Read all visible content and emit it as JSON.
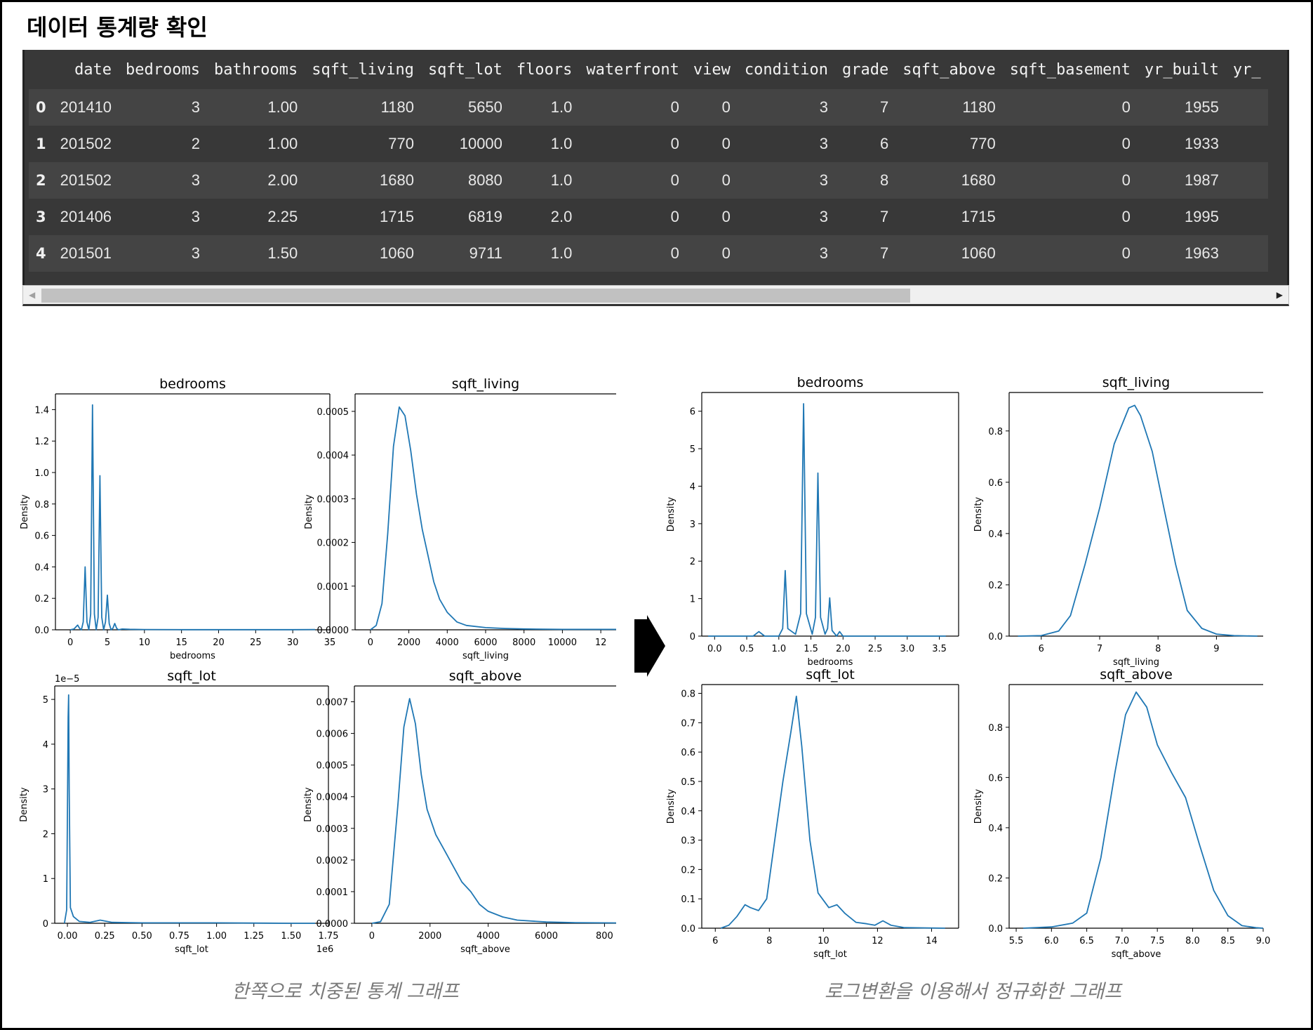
{
  "title": "데이터 통계량 확인",
  "table": {
    "columns": [
      "",
      "date",
      "bedrooms",
      "bathrooms",
      "sqft_living",
      "sqft_lot",
      "floors",
      "waterfront",
      "view",
      "condition",
      "grade",
      "sqft_above",
      "sqft_basement",
      "yr_built",
      "yr_"
    ],
    "rows": [
      [
        "0",
        "201410",
        "3",
        "1.00",
        "1180",
        "5650",
        "1.0",
        "0",
        "0",
        "3",
        "7",
        "1180",
        "0",
        "1955",
        ""
      ],
      [
        "1",
        "201502",
        "2",
        "1.00",
        "770",
        "10000",
        "1.0",
        "0",
        "0",
        "3",
        "6",
        "770",
        "0",
        "1933",
        ""
      ],
      [
        "2",
        "201502",
        "3",
        "2.00",
        "1680",
        "8080",
        "1.0",
        "0",
        "0",
        "3",
        "8",
        "1680",
        "0",
        "1987",
        ""
      ],
      [
        "3",
        "201406",
        "3",
        "2.25",
        "1715",
        "6819",
        "2.0",
        "0",
        "0",
        "3",
        "7",
        "1715",
        "0",
        "1995",
        ""
      ],
      [
        "4",
        "201501",
        "3",
        "1.50",
        "1060",
        "9711",
        "1.0",
        "0",
        "0",
        "3",
        "7",
        "1060",
        "0",
        "1963",
        ""
      ]
    ]
  },
  "scrollbar": {
    "left_arrow": "◀",
    "right_arrow": "▶",
    "thumb_fraction": 0.69
  },
  "arrow_icon": "right-arrow-icon",
  "captions": {
    "left": "한쪽으로 치중된 통계 그래프",
    "right": "로그변환을 이용해서 정규화한 그래프"
  },
  "colors": {
    "line": "#1f77b4",
    "table_bg": "#383838"
  },
  "chart_data": [
    {
      "type": "line",
      "title": "bedrooms",
      "xlabel": "bedrooms",
      "ylabel": "Density",
      "xlim": [
        -2,
        35
      ],
      "ylim": [
        0,
        1.5
      ],
      "xticks": [
        0,
        5,
        10,
        15,
        20,
        25,
        30,
        35
      ],
      "yticks": [
        0.0,
        0.2,
        0.4,
        0.6,
        0.8,
        1.0,
        1.2,
        1.4
      ],
      "ytick_labels": [
        "0.0",
        "0.2",
        "0.4",
        "0.6",
        "0.8",
        "1.0",
        "1.2",
        "1.4"
      ],
      "series": [
        {
          "x": [
            0,
            0.5,
            1,
            1.25,
            1.5,
            1.75,
            2,
            2.25,
            2.5,
            2.75,
            3,
            3.25,
            3.5,
            3.75,
            4,
            4.25,
            4.5,
            4.75,
            5,
            5.25,
            5.5,
            5.75,
            6,
            6.25,
            6.5,
            7,
            8,
            10,
            15,
            20,
            25,
            30,
            33
          ],
          "y": [
            0,
            0.005,
            0.03,
            0.01,
            0.0,
            0.05,
            0.4,
            0.05,
            0.0,
            0.1,
            1.43,
            0.1,
            0.0,
            0.08,
            0.98,
            0.08,
            0.0,
            0.05,
            0.22,
            0.04,
            0.0,
            0.01,
            0.04,
            0.01,
            0.0,
            0.005,
            0.003,
            0.002,
            0.001,
            0.001,
            0.001,
            0.001,
            0.002
          ]
        }
      ]
    },
    {
      "type": "line",
      "title": "sqft_living",
      "xlabel": "sqft_living",
      "ylabel": "Density",
      "xlim": [
        -800,
        12800
      ],
      "ylim": [
        0,
        0.00054
      ],
      "xticks": [
        0,
        2000,
        4000,
        6000,
        8000,
        10000,
        12000
      ],
      "xtick_labels": [
        "0",
        "2000",
        "4000",
        "6000",
        "8000",
        "10000",
        "12"
      ],
      "yticks": [
        0.0,
        0.0001,
        0.0002,
        0.0003,
        0.0004,
        0.0005
      ],
      "ytick_labels": [
        "0.0000",
        "0.0001",
        "0.0002",
        "0.0003",
        "0.0004",
        "0.0005"
      ],
      "series": [
        {
          "x": [
            0,
            300,
            600,
            900,
            1200,
            1500,
            1800,
            2100,
            2400,
            2700,
            3000,
            3300,
            3600,
            4000,
            4500,
            5000,
            6000,
            7000,
            8000,
            10000,
            12800
          ],
          "y": [
            0,
            1e-05,
            6e-05,
            0.00022,
            0.00042,
            0.00051,
            0.00049,
            0.00041,
            0.00031,
            0.00023,
            0.00017,
            0.00011,
            7e-05,
            4e-05,
            1.8e-05,
            1e-05,
            5e-06,
            3e-06,
            2e-06,
            1e-06,
            1e-06
          ]
        }
      ]
    },
    {
      "type": "line",
      "title": "sqft_lot",
      "xlabel": "sqft_lot",
      "ylabel": "Density",
      "offset_label": "1e−5",
      "xoffset_label": "1e6",
      "xlim": [
        -0.085,
        1.75
      ],
      "ylim": [
        0,
        5.3
      ],
      "xticks": [
        0,
        0.25,
        0.5,
        0.75,
        1.0,
        1.25,
        1.5,
        1.75
      ],
      "xtick_labels": [
        "0.00",
        "0.25",
        "0.50",
        "0.75",
        "1.00",
        "1.25",
        "1.50",
        "1.75"
      ],
      "yticks": [
        0,
        1,
        2,
        3,
        4,
        5
      ],
      "series": [
        {
          "x": [
            -0.02,
            -0.005,
            0.0,
            0.005,
            0.008,
            0.012,
            0.02,
            0.04,
            0.08,
            0.15,
            0.22,
            0.3,
            0.5,
            1.0,
            1.5,
            1.66
          ],
          "y": [
            0,
            0.3,
            2.5,
            4.6,
            5.1,
            3.0,
            0.35,
            0.15,
            0.04,
            0.02,
            0.07,
            0.02,
            0.01,
            0.01,
            0.0,
            0.0
          ]
        }
      ]
    },
    {
      "type": "line",
      "title": "sqft_above",
      "xlabel": "sqft_above",
      "ylabel": "Density",
      "xlim": [
        -600,
        8400
      ],
      "ylim": [
        0,
        0.00075
      ],
      "xticks": [
        0,
        2000,
        4000,
        6000,
        8000
      ],
      "xtick_labels": [
        "0",
        "2000",
        "4000",
        "6000",
        "800"
      ],
      "yticks": [
        0,
        0.0001,
        0.0002,
        0.0003,
        0.0004,
        0.0005,
        0.0006,
        0.0007
      ],
      "ytick_labels": [
        "0.0000",
        "0.0001",
        "0.0002",
        "0.0003",
        "0.0004",
        "0.0005",
        "0.0006",
        "0.0007"
      ],
      "series": [
        {
          "x": [
            0,
            300,
            600,
            900,
            1100,
            1300,
            1500,
            1700,
            1900,
            2200,
            2500,
            2800,
            3100,
            3400,
            3700,
            4000,
            4500,
            5000,
            6000,
            7000,
            8400
          ],
          "y": [
            0,
            5e-06,
            6e-05,
            0.00038,
            0.00062,
            0.00071,
            0.00063,
            0.00047,
            0.00036,
            0.00028,
            0.00023,
            0.00018,
            0.00013,
            0.0001,
            6e-05,
            3.8e-05,
            2e-05,
            1e-05,
            4e-06,
            2e-06,
            1e-06
          ]
        }
      ]
    },
    {
      "type": "line",
      "title": "bedrooms",
      "xlabel": "bedrooms",
      "ylabel": "Density",
      "xlim": [
        -0.2,
        3.8
      ],
      "ylim": [
        0,
        6.5
      ],
      "xticks": [
        0,
        0.5,
        1.0,
        1.5,
        2.0,
        2.5,
        3.0,
        3.5
      ],
      "xtick_labels": [
        "0.0",
        "0.5",
        "1.0",
        "1.5",
        "2.0",
        "2.5",
        "3.0",
        "3.5"
      ],
      "yticks": [
        0,
        1,
        2,
        3,
        4,
        5,
        6
      ],
      "series": [
        {
          "x": [
            -0.1,
            0.6,
            0.69,
            0.78,
            1.0,
            1.06,
            1.099,
            1.14,
            1.26,
            1.34,
            1.386,
            1.43,
            1.52,
            1.57,
            1.609,
            1.65,
            1.72,
            1.76,
            1.792,
            1.83,
            1.9,
            1.946,
            2.0,
            2.2,
            3.6
          ],
          "y": [
            0,
            0,
            0.12,
            0,
            0,
            0.2,
            1.75,
            0.2,
            0.05,
            0.6,
            6.2,
            0.6,
            0.05,
            0.5,
            4.35,
            0.5,
            0.05,
            0.2,
            1.02,
            0.15,
            0.0,
            0.12,
            0.0,
            0.0,
            0.0
          ]
        }
      ]
    },
    {
      "type": "line",
      "title": "sqft_living",
      "xlabel": "sqft_living",
      "ylabel": "Density",
      "xlim": [
        5.45,
        9.8
      ],
      "ylim": [
        0,
        0.95
      ],
      "xticks": [
        6,
        7,
        8,
        9
      ],
      "yticks": [
        0,
        0.2,
        0.4,
        0.6,
        0.8
      ],
      "ytick_labels": [
        "0.0",
        "0.2",
        "0.4",
        "0.6",
        "0.8"
      ],
      "series": [
        {
          "x": [
            5.6,
            6.0,
            6.3,
            6.5,
            6.75,
            7.0,
            7.25,
            7.5,
            7.6,
            7.7,
            7.9,
            8.1,
            8.3,
            8.5,
            8.75,
            9.0,
            9.3,
            9.7
          ],
          "y": [
            0,
            0.002,
            0.02,
            0.08,
            0.28,
            0.5,
            0.75,
            0.89,
            0.9,
            0.86,
            0.72,
            0.5,
            0.28,
            0.1,
            0.03,
            0.008,
            0.002,
            0
          ]
        }
      ]
    },
    {
      "type": "line",
      "title": "sqft_lot",
      "xlabel": "sqft_lot",
      "ylabel": "Density",
      "xlim": [
        5.5,
        15.0
      ],
      "ylim": [
        0,
        0.83
      ],
      "xticks": [
        6,
        8,
        10,
        12,
        14
      ],
      "yticks": [
        0,
        0.1,
        0.2,
        0.3,
        0.4,
        0.5,
        0.6,
        0.7,
        0.8
      ],
      "ytick_labels": [
        "0.0",
        "0.1",
        "0.2",
        "0.3",
        "0.4",
        "0.5",
        "0.6",
        "0.7",
        "0.8"
      ],
      "series": [
        {
          "x": [
            6.2,
            6.5,
            6.8,
            7.1,
            7.3,
            7.6,
            7.9,
            8.2,
            8.5,
            8.8,
            9.0,
            9.2,
            9.5,
            9.8,
            10.2,
            10.5,
            10.8,
            11.2,
            11.6,
            11.9,
            12.2,
            12.5,
            13.0,
            14.5
          ],
          "y": [
            0,
            0.01,
            0.04,
            0.08,
            0.07,
            0.06,
            0.1,
            0.3,
            0.5,
            0.67,
            0.79,
            0.62,
            0.3,
            0.12,
            0.07,
            0.08,
            0.05,
            0.02,
            0.015,
            0.01,
            0.025,
            0.01,
            0.002,
            0
          ]
        }
      ]
    },
    {
      "type": "line",
      "title": "sqft_above",
      "xlabel": "sqft_above",
      "ylabel": "Density",
      "xlim": [
        5.4,
        9.0
      ],
      "ylim": [
        0,
        0.97
      ],
      "xticks": [
        5.5,
        6.0,
        6.5,
        7.0,
        7.5,
        8.0,
        8.5,
        9.0
      ],
      "xtick_labels": [
        "5.5",
        "6.0",
        "6.5",
        "7.0",
        "7.5",
        "8.0",
        "8.5",
        "9.0"
      ],
      "yticks": [
        0,
        0.2,
        0.4,
        0.6,
        0.8
      ],
      "ytick_labels": [
        "0.0",
        "0.2",
        "0.4",
        "0.6",
        "0.8"
      ],
      "series": [
        {
          "x": [
            5.6,
            6.0,
            6.3,
            6.5,
            6.7,
            6.9,
            7.05,
            7.2,
            7.35,
            7.5,
            7.7,
            7.9,
            8.1,
            8.3,
            8.5,
            8.7,
            8.9,
            9.0
          ],
          "y": [
            0,
            0.005,
            0.02,
            0.06,
            0.28,
            0.62,
            0.85,
            0.94,
            0.88,
            0.73,
            0.62,
            0.52,
            0.33,
            0.15,
            0.05,
            0.01,
            0.002,
            0
          ]
        }
      ]
    }
  ]
}
